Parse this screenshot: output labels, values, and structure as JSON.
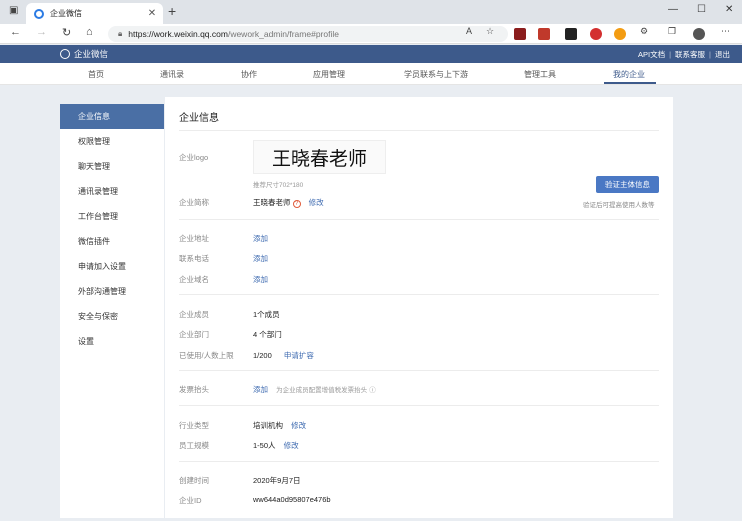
{
  "browser": {
    "tab_title": "企业微信",
    "url_host": "https://work.weixin.qq.com",
    "url_path": "/wework_admin/frame#profile"
  },
  "header": {
    "brand": "企业微信",
    "links": [
      "API文档",
      "联系客服",
      "退出"
    ]
  },
  "nav": {
    "items": [
      "首页",
      "通讯录",
      "协作",
      "应用管理",
      "学员联系与上下游",
      "管理工具",
      "我的企业"
    ],
    "active": "我的企业"
  },
  "sidebar": {
    "items": [
      "企业信息",
      "权限管理",
      "聊天管理",
      "通讯录管理",
      "工作台管理",
      "微信插件",
      "申请加入设置",
      "外部沟通管理",
      "安全与保密",
      "设置"
    ],
    "active": "企业信息"
  },
  "panel": {
    "title": "企业信息",
    "logo_label": "企业logo",
    "logo_text": "王晓春老师",
    "logo_hint": "推荐尺寸702*180",
    "verify_button": "验证主体信息",
    "verify_note": "验证后可提高使用人数等",
    "name_label": "企业简称",
    "name_value": "王晓春老师",
    "edit": "修改",
    "add": "添加",
    "address_label": "企业地址",
    "phone_label": "联系电话",
    "domain_label": "企业域名",
    "members_label": "企业成员",
    "members_value": "1个成员",
    "depts_label": "企业部门",
    "depts_value": "4 个部门",
    "used_label": "已使用/人数上限",
    "used_value": "1/200",
    "expand": "申请扩容",
    "invoice_label": "发票抬头",
    "invoice_note": "为企业成员配置增值税发票抬头",
    "industry_label": "行业类型",
    "industry_value": "培训机构",
    "scale_label": "员工规模",
    "scale_value": "1-50人",
    "created_label": "创建时间",
    "created_value": "2020年9月7日",
    "corpid_label": "企业ID",
    "corpid_value": "ww644a0d95807e476b"
  },
  "icons": [
    "window-icon",
    "close-icon",
    "new-tab-icon",
    "back-icon",
    "forward-icon",
    "reload-icon",
    "home-icon",
    "lock-icon",
    "read-aloud-icon",
    "favorite-icon",
    "extensions-icon",
    "collections-icon",
    "profile-avatar-icon",
    "menu-icon",
    "question-icon",
    "info-icon"
  ]
}
